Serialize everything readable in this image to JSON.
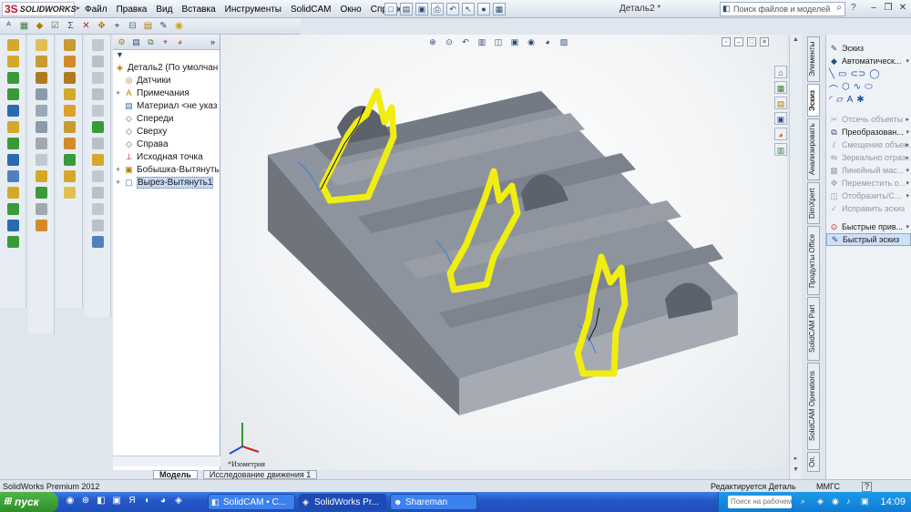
{
  "app": {
    "logo_text": "SOLIDWORKS",
    "doc_title": "Деталь2 *"
  },
  "menus": [
    "Файл",
    "Правка",
    "Вид",
    "Вставка",
    "Инструменты",
    "SolidCAM",
    "Окно",
    "Справка"
  ],
  "search": {
    "placeholder": "Поиск файлов и моделей"
  },
  "tree": {
    "filter_icon": "filter-icon",
    "items": [
      {
        "label": "Деталь2  (По умолчан",
        "icon": "part-icon",
        "expand": ""
      },
      {
        "label": "Датчики",
        "icon": "sensor-icon",
        "expand": ""
      },
      {
        "label": "Примечания",
        "icon": "annotation-icon",
        "expand": "+"
      },
      {
        "label": "Материал <не указ",
        "icon": "material-icon",
        "expand": ""
      },
      {
        "label": "Спереди",
        "icon": "plane-icon",
        "expand": ""
      },
      {
        "label": "Сверху",
        "icon": "plane-icon",
        "expand": ""
      },
      {
        "label": "Справа",
        "icon": "plane-icon",
        "expand": ""
      },
      {
        "label": "Исходная точка",
        "icon": "origin-icon",
        "expand": ""
      },
      {
        "label": "Бобышка-Вытянуть",
        "icon": "extrude-boss-icon",
        "expand": "+"
      },
      {
        "label": "Вырез-Вытянуть1",
        "icon": "extrude-cut-icon",
        "expand": "+"
      }
    ]
  },
  "bottom_tabs": [
    "Модель",
    "Исследование движения 1"
  ],
  "viewport": {
    "orientation": "*Изометрия"
  },
  "cm_tabs": [
    "Элементы",
    "Эскиз",
    "Анализировать",
    "DimXpert",
    "Продукты Office",
    "SolidCAM Part",
    "SolidCAM Operations",
    "Оп."
  ],
  "sketch_panel": {
    "rows": [
      {
        "label": "Эскиз",
        "state": "normal",
        "icon": "sketch-icon",
        "dd": ""
      },
      {
        "label": "Автоматическ...",
        "state": "normal",
        "icon": "smart-dimension-icon",
        "dd": "▾"
      },
      {
        "label": "Отсечь объекты",
        "state": "disabled",
        "icon": "trim-icon",
        "dd": "▸"
      },
      {
        "label": "Преобразован...",
        "state": "normal",
        "icon": "convert-icon",
        "dd": "▾"
      },
      {
        "label": "Смещение объек...",
        "state": "disabled",
        "icon": "offset-icon",
        "dd": "▸"
      },
      {
        "label": "Зеркально отраз...",
        "state": "disabled",
        "icon": "mirror-icon",
        "dd": "▸"
      },
      {
        "label": "Линейный мас...",
        "state": "disabled",
        "icon": "linear-pattern-icon",
        "dd": "▾"
      },
      {
        "label": "Переместить о...",
        "state": "disabled",
        "icon": "move-icon",
        "dd": "▾"
      },
      {
        "label": "Отобразить/С...",
        "state": "disabled",
        "icon": "display-icon",
        "dd": "▾"
      },
      {
        "label": "Исправить эскиз",
        "state": "disabled",
        "icon": "repair-icon",
        "dd": ""
      },
      {
        "label": "Быстрые прив...",
        "state": "normal",
        "icon": "snap-icon",
        "dd": "▾"
      },
      {
        "label": "Быстрый эскиз",
        "state": "highlight",
        "icon": "rapid-sketch-icon",
        "dd": ""
      }
    ]
  },
  "status": {
    "left": "SolidWorks Premium 2012",
    "editing": "Редактируется Деталь",
    "units": "ММГС",
    "help": "?"
  },
  "taskbar": {
    "start": "пуск",
    "tasks": [
      "SolidCAM • C...",
      "SolidWorks Pr...",
      "Shareman"
    ],
    "tray_search": "Поиск на рабочем с...",
    "clock": "14:09"
  }
}
